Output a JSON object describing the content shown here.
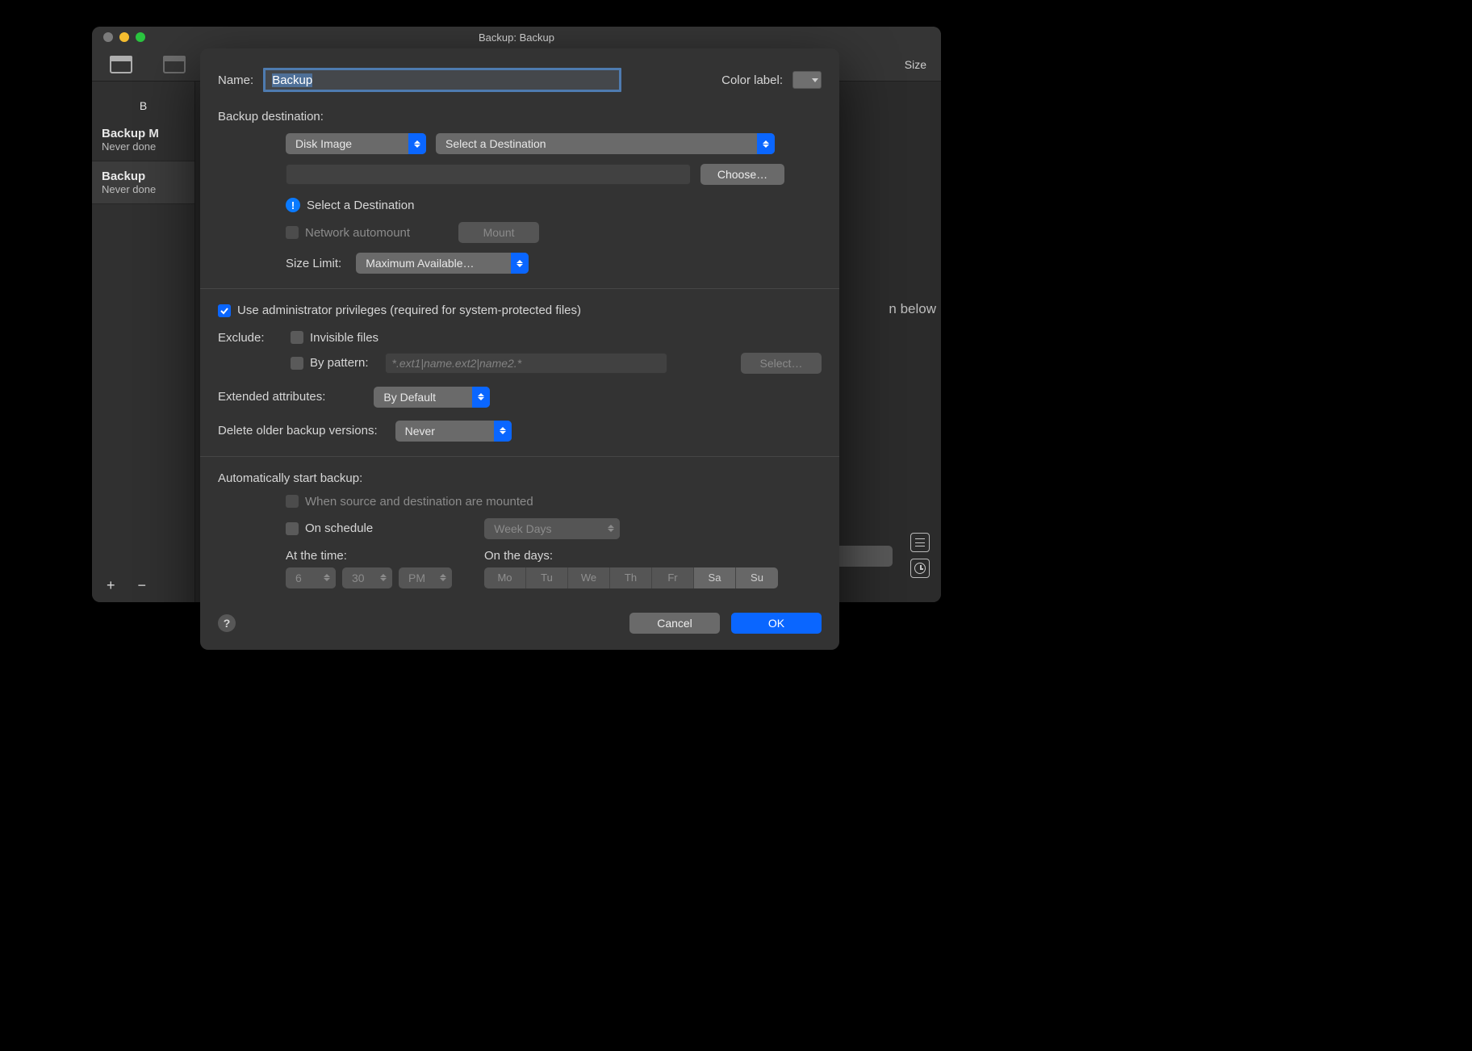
{
  "window": {
    "title": "Backup: Backup"
  },
  "toolbar": {
    "size_label": "Size"
  },
  "sidebar": {
    "top": "B",
    "items": [
      {
        "title": "Backup M",
        "subtitle": "Never done"
      },
      {
        "title": "Backup",
        "subtitle": "Never done"
      }
    ],
    "plus": "+",
    "minus": "−"
  },
  "content": {
    "below": "n below"
  },
  "dialog": {
    "name_label": "Name:",
    "name_value": "Backup",
    "color_label": "Color label:",
    "destination_title": "Backup destination:",
    "dest_type": "Disk Image",
    "dest_select": "Select a Destination",
    "choose": "Choose…",
    "warn": "Select a Destination",
    "automount": "Network automount",
    "mount": "Mount",
    "size_limit_label": "Size Limit:",
    "size_limit": "Maximum Available…",
    "admin": "Use administrator privileges (required for system-protected files)",
    "exclude_label": "Exclude:",
    "invisible": "Invisible files",
    "by_pattern": "By pattern:",
    "pattern_placeholder": "*.ext1|name.ext2|name2.*",
    "select_btn": "Select…",
    "ext_attr_label": "Extended attributes:",
    "ext_attr": "By Default",
    "delete_label": "Delete older backup versions:",
    "delete_val": "Never",
    "auto_title": "Automatically start backup:",
    "when_mounted": "When source and destination are mounted",
    "on_schedule": "On schedule",
    "schedule_mode": "Week Days",
    "at_time": "At the time:",
    "hour": "6",
    "minute": "30",
    "ampm": "PM",
    "on_days": "On the days:",
    "days": [
      "Mo",
      "Tu",
      "We",
      "Th",
      "Fr",
      "Sa",
      "Su"
    ],
    "cancel": "Cancel",
    "ok": "OK",
    "help": "?"
  }
}
